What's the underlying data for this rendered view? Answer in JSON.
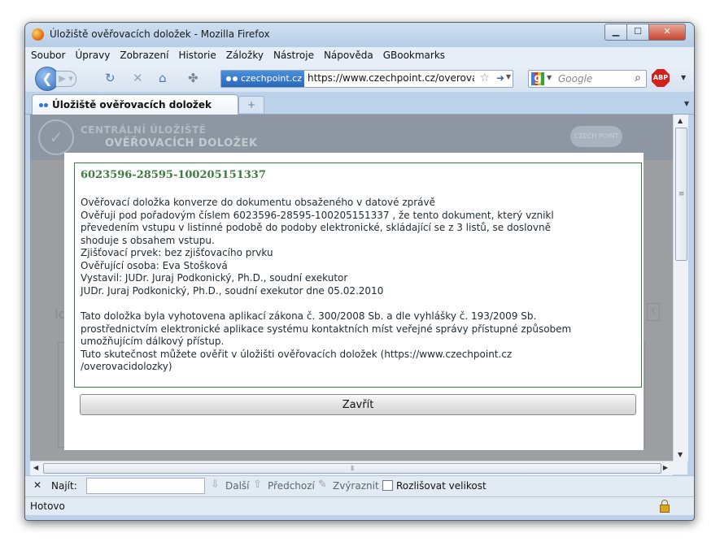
{
  "window": {
    "title": "Úložiště ověřovacích doložek - Mozilla Firefox"
  },
  "menu": [
    "Soubor",
    "Úpravy",
    "Zobrazení",
    "Historie",
    "Záložky",
    "Nástroje",
    "Nápověda",
    "GBookmarks"
  ],
  "navbar": {
    "site_identity": "czechpoint.cz",
    "url": "https://www.czechpoint.cz/overovaci",
    "search_placeholder": "Google",
    "adblock_label": "ABP"
  },
  "tab": {
    "label": "Úložiště ověřovacích doložek"
  },
  "site": {
    "header_line1": "CENTRÁLNÍ ÚLOŽIŠTĚ",
    "header_line2": "OVĚŘOVACÍCH DOLOŽEK",
    "logo_text": "CZECH POINT",
    "bg_text": "Ic"
  },
  "dialog": {
    "cert_id": "6023596-28595-100205151337",
    "lines": [
      "Ověřovací doložka konverze do dokumentu obsaženého v datové zprávě",
      "Ověřuji pod pořadovým číslem 6023596-28595-100205151337 , že tento dokument, který vznikl",
      "převedením vstupu v listinné podobě do podoby elektronické, skládající se z 3 listů, se doslovně",
      "shoduje s obsahem vstupu.",
      "Zjišťovací prvek: bez zjišťovacího prvku",
      "Ověřující osoba: Eva Stošková",
      "Vystavil: JUDr. Juraj Podkonický, Ph.D., soudní exekutor",
      "JUDr. Juraj Podkonický, Ph.D., soudní exekutor dne 05.02.2010"
    ],
    "footer_lines": [
      "Tato doložka byla vyhotovena aplikací zákona č. 300/2008 Sb. a dle vyhlášky č. 193/2009 Sb.",
      "prostřednictvím elektronické aplikace systému kontaktních míst veřejné správy přístupné způsobem",
      "umožňujícím dálkový přístup.",
      "Tuto skutečnost můžete ověřit v úložišti ověřovacích doložek (https://www.czechpoint.cz",
      "/overovacidolozky)"
    ],
    "close_label": "Zavřít"
  },
  "findbar": {
    "label": "Najít:",
    "value": "",
    "next": "Další",
    "prev": "Předchozí",
    "highlight": "Zvýraznit",
    "match_case": "Rozlišovat velikost"
  },
  "status": {
    "text": "Hotovo"
  }
}
